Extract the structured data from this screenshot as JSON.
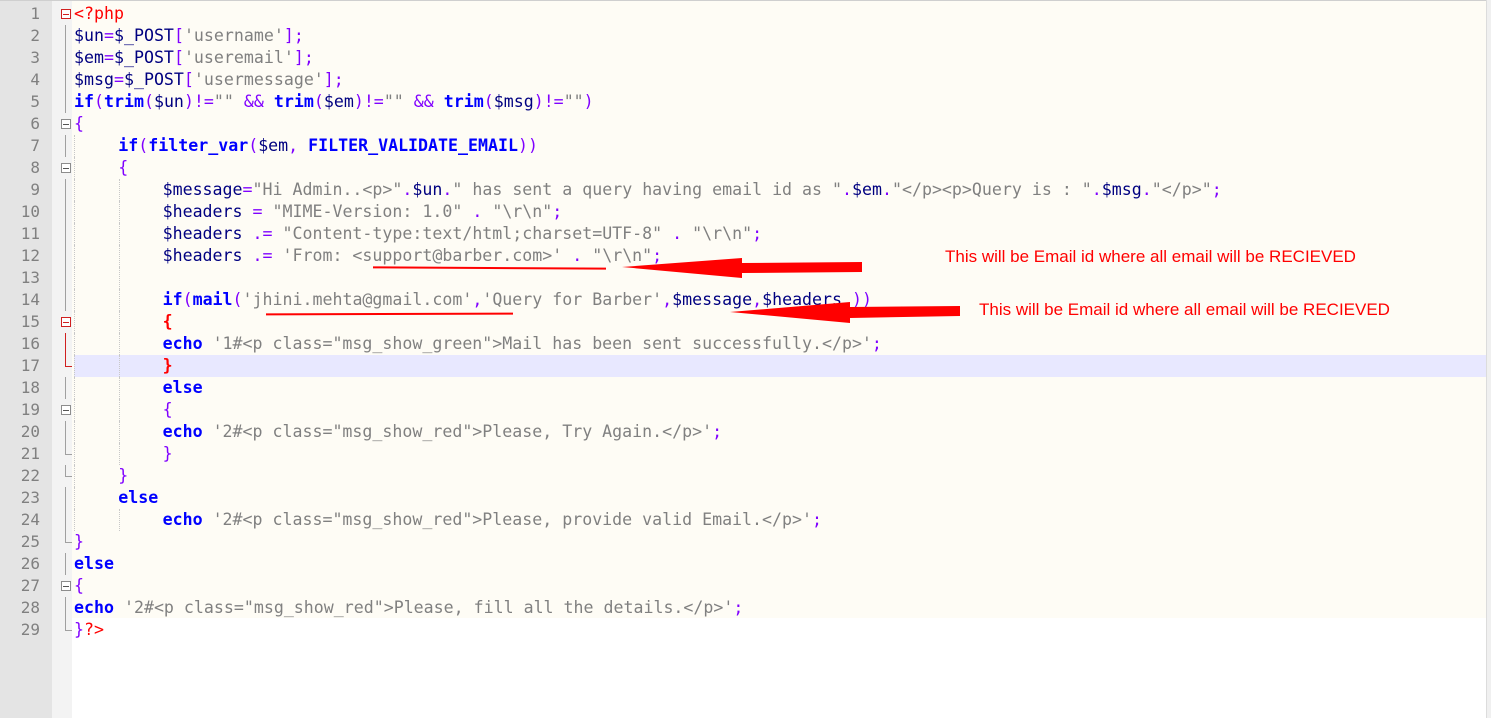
{
  "editor": {
    "language": "php",
    "current_line": 17,
    "accent_colors": {
      "keyword": "#0000ff",
      "variable": "#000080",
      "operator": "#8000ff",
      "string": "#808080",
      "tag": "#ff0000",
      "annotation": "#ff0000"
    },
    "lines": [
      {
        "n": "1",
        "fold": "box-red",
        "indent": 0,
        "tokens": [
          [
            "t",
            "<?php"
          ]
        ]
      },
      {
        "n": "2",
        "fold": "line",
        "indent": 0,
        "tokens": [
          [
            "v",
            "$un"
          ],
          [
            "o",
            "="
          ],
          [
            "v",
            "$_POST"
          ],
          [
            "o",
            "["
          ],
          [
            "s",
            "'username'"
          ],
          [
            "o",
            "];"
          ]
        ]
      },
      {
        "n": "3",
        "fold": "line",
        "indent": 0,
        "tokens": [
          [
            "v",
            "$em"
          ],
          [
            "o",
            "="
          ],
          [
            "v",
            "$_POST"
          ],
          [
            "o",
            "["
          ],
          [
            "s",
            "'useremail'"
          ],
          [
            "o",
            "];"
          ]
        ]
      },
      {
        "n": "4",
        "fold": "line",
        "indent": 0,
        "tokens": [
          [
            "v",
            "$msg"
          ],
          [
            "o",
            "="
          ],
          [
            "v",
            "$_POST"
          ],
          [
            "o",
            "["
          ],
          [
            "s",
            "'usermessage'"
          ],
          [
            "o",
            "];"
          ]
        ]
      },
      {
        "n": "5",
        "fold": "line",
        "indent": 0,
        "tokens": [
          [
            "k",
            "if"
          ],
          [
            "o",
            "("
          ],
          [
            "k",
            "trim"
          ],
          [
            "o",
            "("
          ],
          [
            "v",
            "$un"
          ],
          [
            "o",
            ")!="
          ],
          [
            "s",
            "\"\""
          ],
          [
            "o",
            " && "
          ],
          [
            "k",
            "trim"
          ],
          [
            "o",
            "("
          ],
          [
            "v",
            "$em"
          ],
          [
            "o",
            ")!="
          ],
          [
            "s",
            "\"\""
          ],
          [
            "o",
            " && "
          ],
          [
            "k",
            "trim"
          ],
          [
            "o",
            "("
          ],
          [
            "v",
            "$msg"
          ],
          [
            "o",
            ")!="
          ],
          [
            "s",
            "\"\""
          ],
          [
            "o",
            ")"
          ]
        ]
      },
      {
        "n": "6",
        "fold": "box",
        "indent": 0,
        "tokens": [
          [
            "o",
            "{"
          ]
        ]
      },
      {
        "n": "7",
        "fold": "line",
        "indent": 1,
        "tokens": [
          [
            "k",
            "if"
          ],
          [
            "o",
            "("
          ],
          [
            "k",
            "filter_var"
          ],
          [
            "o",
            "("
          ],
          [
            "v",
            "$em"
          ],
          [
            "o",
            ", "
          ],
          [
            "k",
            "FILTER_VALIDATE_EMAIL"
          ],
          [
            "o",
            "))"
          ]
        ]
      },
      {
        "n": "8",
        "fold": "box",
        "indent": 1,
        "tokens": [
          [
            "o",
            "{"
          ]
        ]
      },
      {
        "n": "9",
        "fold": "line",
        "indent": 2,
        "tokens": [
          [
            "v",
            "$message"
          ],
          [
            "o",
            "="
          ],
          [
            "s",
            "\"Hi Admin..<p>\""
          ],
          [
            "o",
            "."
          ],
          [
            "v",
            "$un"
          ],
          [
            "o",
            "."
          ],
          [
            "s",
            "\" has sent a query having email id as \""
          ],
          [
            "o",
            "."
          ],
          [
            "v",
            "$em"
          ],
          [
            "o",
            "."
          ],
          [
            "s",
            "\"</p><p>Query is : \""
          ],
          [
            "o",
            "."
          ],
          [
            "v",
            "$msg"
          ],
          [
            "o",
            "."
          ],
          [
            "s",
            "\"</p>\""
          ],
          [
            "o",
            ";"
          ]
        ]
      },
      {
        "n": "10",
        "fold": "line",
        "indent": 2,
        "tokens": [
          [
            "v",
            "$headers"
          ],
          [
            "o",
            " = "
          ],
          [
            "s",
            "\"MIME-Version: 1.0\""
          ],
          [
            "o",
            " . "
          ],
          [
            "s",
            "\"\\r\\n\""
          ],
          [
            "o",
            ";"
          ]
        ]
      },
      {
        "n": "11",
        "fold": "line",
        "indent": 2,
        "tokens": [
          [
            "v",
            "$headers"
          ],
          [
            "o",
            " .= "
          ],
          [
            "s",
            "\"Content-type:text/html;charset=UTF-8\""
          ],
          [
            "o",
            " . "
          ],
          [
            "s",
            "\"\\r\\n\""
          ],
          [
            "o",
            ";"
          ]
        ]
      },
      {
        "n": "12",
        "fold": "line",
        "indent": 2,
        "tokens": [
          [
            "v",
            "$headers"
          ],
          [
            "o",
            " .= "
          ],
          [
            "s",
            "'From: <support@barber.com>'"
          ],
          [
            "o",
            " . "
          ],
          [
            "s",
            "\"\\r\\n\""
          ],
          [
            "o",
            ";"
          ]
        ]
      },
      {
        "n": "13",
        "fold": "line",
        "indent": 2,
        "tokens": []
      },
      {
        "n": "14",
        "fold": "line",
        "indent": 2,
        "tokens": [
          [
            "k",
            "if"
          ],
          [
            "o",
            "("
          ],
          [
            "k",
            "mail"
          ],
          [
            "o",
            "("
          ],
          [
            "s",
            "'jhini.mehta@gmail.com'"
          ],
          [
            "o",
            ","
          ],
          [
            "s",
            "'Query for Barber'"
          ],
          [
            "o",
            ","
          ],
          [
            "v",
            "$message"
          ],
          [
            "o",
            ","
          ],
          [
            "v",
            "$headers"
          ],
          [
            "o",
            " ))"
          ]
        ]
      },
      {
        "n": "15",
        "fold": "box-red",
        "indent": 2,
        "tokens": [
          [
            "hb",
            "{"
          ]
        ]
      },
      {
        "n": "16",
        "fold": "line-red",
        "indent": 2,
        "tokens": [
          [
            "k",
            "echo"
          ],
          [
            "o",
            " "
          ],
          [
            "s",
            "'1#<p class=\"msg_show_green\">Mail has been sent successfully.</p>'"
          ],
          [
            "o",
            ";"
          ]
        ]
      },
      {
        "n": "17",
        "fold": "corner-red",
        "indent": 2,
        "tokens": [
          [
            "hb",
            "}"
          ]
        ]
      },
      {
        "n": "18",
        "fold": "line",
        "indent": 2,
        "tokens": [
          [
            "k",
            "else"
          ]
        ]
      },
      {
        "n": "19",
        "fold": "box",
        "indent": 2,
        "tokens": [
          [
            "o",
            "{"
          ]
        ]
      },
      {
        "n": "20",
        "fold": "line",
        "indent": 2,
        "tokens": [
          [
            "k",
            "echo"
          ],
          [
            "o",
            " "
          ],
          [
            "s",
            "'2#<p class=\"msg_show_red\">Please, Try Again.</p>'"
          ],
          [
            "o",
            ";"
          ]
        ]
      },
      {
        "n": "21",
        "fold": "corner",
        "indent": 2,
        "tokens": [
          [
            "o",
            "}"
          ]
        ]
      },
      {
        "n": "22",
        "fold": "corner",
        "indent": 1,
        "tokens": [
          [
            "o",
            "}"
          ]
        ]
      },
      {
        "n": "23",
        "fold": "line",
        "indent": 1,
        "tokens": [
          [
            "k",
            "else"
          ]
        ]
      },
      {
        "n": "24",
        "fold": "line",
        "indent": 2,
        "tokens": [
          [
            "k",
            "echo"
          ],
          [
            "o",
            " "
          ],
          [
            "s",
            "'2#<p class=\"msg_show_red\">Please, provide valid Email.</p>'"
          ],
          [
            "o",
            ";"
          ]
        ]
      },
      {
        "n": "25",
        "fold": "corner",
        "indent": 0,
        "tokens": [
          [
            "o",
            "}"
          ]
        ]
      },
      {
        "n": "26",
        "fold": "line",
        "indent": 0,
        "tokens": [
          [
            "k",
            "else"
          ]
        ]
      },
      {
        "n": "27",
        "fold": "box",
        "indent": 0,
        "tokens": [
          [
            "o",
            "{"
          ]
        ]
      },
      {
        "n": "28",
        "fold": "line",
        "indent": 0,
        "tokens": [
          [
            "k",
            "echo"
          ],
          [
            "o",
            " "
          ],
          [
            "s",
            "'2#<p class=\"msg_show_red\">Please, fill all the details.</p>'"
          ],
          [
            "o",
            ";"
          ]
        ]
      },
      {
        "n": "29",
        "fold": "corner",
        "indent": 0,
        "tokens": [
          [
            "o",
            "}"
          ],
          [
            "t",
            "?>"
          ]
        ]
      }
    ]
  },
  "annotations": {
    "note_1": "This will be Email id where all email will be RECIEVED",
    "note_2": "This will be Email id where all email will be RECIEVED"
  }
}
